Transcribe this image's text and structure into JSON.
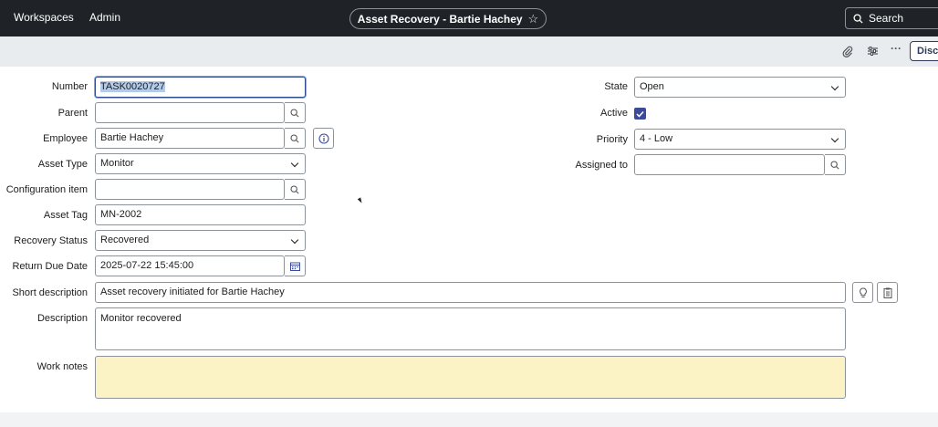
{
  "nav": {
    "workspaces": "Workspaces",
    "admin": "Admin",
    "title": "Asset Recovery - Bartie Hachey",
    "search": "Search"
  },
  "toolbar": {
    "icons": [
      "paperclip-icon",
      "sliders-icon",
      "more-icon"
    ],
    "discuss_label": "Discuss"
  },
  "form": {
    "number": {
      "label": "Number",
      "value": "TASK0020727"
    },
    "parent": {
      "label": "Parent",
      "value": ""
    },
    "employee": {
      "label": "Employee",
      "value": "Bartie Hachey"
    },
    "asset_type": {
      "label": "Asset Type",
      "value": "Monitor"
    },
    "configuration_item": {
      "label": "Configuration item",
      "value": ""
    },
    "asset_tag": {
      "label": "Asset Tag",
      "value": "MN-2002"
    },
    "recovery_status": {
      "label": "Recovery Status",
      "value": "Recovered"
    },
    "return_due_date": {
      "label": "Return Due Date",
      "value": "2025-07-22 15:45:00"
    },
    "short_description": {
      "label": "Short description",
      "value": "Asset recovery initiated for Bartie Hachey"
    },
    "description": {
      "label": "Description",
      "value": "Monitor recovered"
    },
    "work_notes": {
      "label": "Work notes",
      "value": ""
    },
    "state": {
      "label": "State",
      "value": "Open"
    },
    "active": {
      "label": "Active",
      "checked": true
    },
    "priority": {
      "label": "Priority",
      "value": "4 - Low"
    },
    "assigned_to": {
      "label": "Assigned to",
      "value": ""
    }
  },
  "colors": {
    "nav_bg": "#1f2327",
    "toolbar_bg": "#e9ecef",
    "checkbox": "#3c4a9c",
    "work_notes_bg": "#fbf3c5",
    "selection": "#b3cbe9"
  }
}
